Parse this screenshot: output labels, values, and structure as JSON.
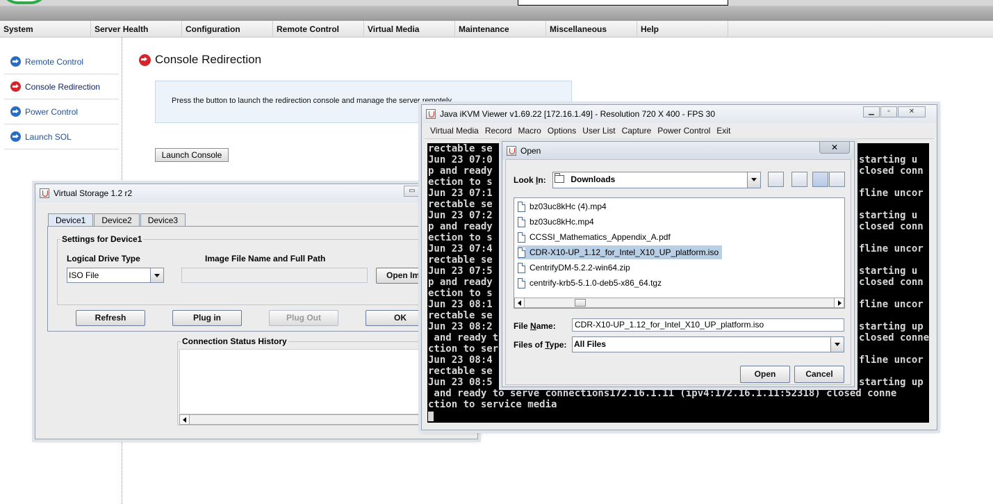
{
  "menu": [
    "System",
    "Server Health",
    "Configuration",
    "Remote Control",
    "Virtual Media",
    "Maintenance",
    "Miscellaneous",
    "Help"
  ],
  "sidebar": [
    {
      "label": "Remote Control",
      "icon": "arrow-circle-blue-icon",
      "active": false
    },
    {
      "label": "Console Redirection",
      "icon": "arrow-circle-red-icon",
      "active": true
    },
    {
      "label": "Power Control",
      "icon": "arrow-circle-blue-icon",
      "active": false
    },
    {
      "label": "Launch SOL",
      "icon": "arrow-circle-blue-icon",
      "active": false
    }
  ],
  "page": {
    "title": "Console Redirection",
    "info": "Press the button to launch the redirection console and manage the server remotely.",
    "launch_button": "Launch Console"
  },
  "virtual_storage": {
    "title": "Virtual Storage 1.2 r2",
    "tabs": [
      "Device1",
      "Device2",
      "Device3"
    ],
    "settings_title": "Settings for Device1",
    "drive_type_label": "Logical Drive Type",
    "drive_type_value": "ISO File",
    "image_label": "Image File Name and Full Path",
    "image_value": "",
    "open_image_button": "Open Im",
    "buttons": {
      "refresh": "Refresh",
      "plug_in": "Plug in",
      "plug_out": "Plug Out",
      "ok": "OK"
    },
    "history_title": "Connection Status History"
  },
  "kvm": {
    "title": "Java iKVM Viewer v1.69.22 [172.16.1.49]  - Resolution 720 X 400 - FPS 30",
    "menu": [
      "Virtual Media",
      "Record",
      "Macro",
      "Options",
      "User List",
      "Capture",
      "Power Control",
      "Exit"
    ],
    "console_left": [
      "rectable se",
      "Jun 23 07:0",
      "p and ready",
      "ection to s",
      "Jun 23 07:1",
      "rectable se",
      "Jun 23 07:2",
      "p and ready",
      "ection to s",
      "Jun 23 07:4",
      "rectable se",
      "Jun 23 07:5",
      "p and ready",
      "ection to s",
      "Jun 23 08:1",
      "rectable se",
      "Jun 23 08:2",
      " and ready t",
      "ction to ser",
      "Jun 23 08:4",
      "rectable se",
      "Jun 23 08:5",
      " and ready to serve connections172.16.1.11 (ipv4:172.16.1.11:52318) closed conne",
      "ction to service media"
    ],
    "console_right": [
      {
        "row": 1,
        "text": "starting u"
      },
      {
        "row": 2,
        "text": "closed conn"
      },
      {
        "row": 4,
        "text": "fline uncor"
      },
      {
        "row": 6,
        "text": "starting u"
      },
      {
        "row": 7,
        "text": "closed conn"
      },
      {
        "row": 9,
        "text": "fline uncor"
      },
      {
        "row": 11,
        "text": "starting u"
      },
      {
        "row": 12,
        "text": "closed conn"
      },
      {
        "row": 14,
        "text": "fline uncor"
      },
      {
        "row": 16,
        "text": "starting up"
      },
      {
        "row": 17,
        "text": "closed conne"
      },
      {
        "row": 19,
        "text": "fline uncor"
      },
      {
        "row": 21,
        "text": "starting up"
      }
    ]
  },
  "open_dialog": {
    "title": "Open",
    "look_in_label": "Look In:",
    "look_in_value": "Downloads",
    "files": [
      {
        "name": "bz03uc8kHc (4).mp4",
        "selected": false
      },
      {
        "name": "bz03uc8kHc.mp4",
        "selected": false
      },
      {
        "name": "CCSSI_Mathematics_Appendix_A.pdf",
        "selected": false
      },
      {
        "name": "CDR-X10-UP_1.12_for_Intel_X10_UP_platform.iso",
        "selected": true
      },
      {
        "name": "CentrifyDM-5.2.2-win64.zip",
        "selected": false
      },
      {
        "name": "centrify-krb5-5.1.0-deb5-x86_64.tgz",
        "selected": false
      }
    ],
    "file_name_label": "File Name:",
    "file_name_value": "CDR-X10-UP_1.12_for_Intel_X10_UP_platform.iso",
    "files_of_type_label": "Files of Type:",
    "files_of_type_value": "All Files",
    "open_button": "Open",
    "cancel_button": "Cancel"
  }
}
